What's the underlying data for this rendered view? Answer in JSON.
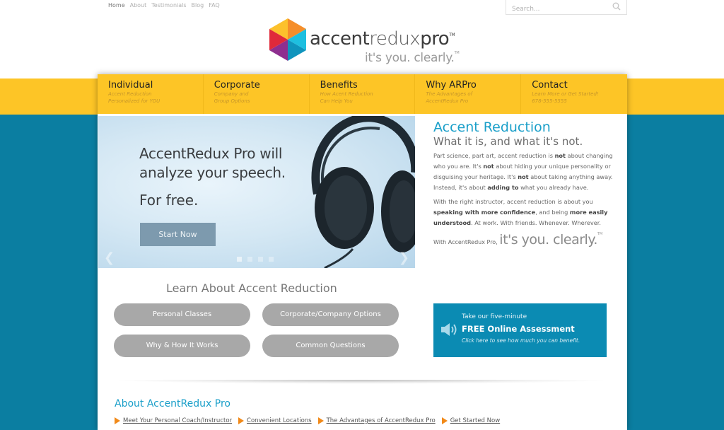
{
  "top_nav": {
    "items": [
      {
        "label": "Home",
        "active": true
      },
      {
        "label": "About"
      },
      {
        "label": "Testimonials"
      },
      {
        "label": "Blog"
      },
      {
        "label": "FAQ"
      }
    ]
  },
  "search": {
    "placeholder": "Search...",
    "icon": "search-icon"
  },
  "logo": {
    "word_bold_1": "accent",
    "word_light": "redux",
    "word_bold_2": "pro",
    "tm": "TM",
    "tagline": "it's you. clearly.",
    "tagline_tm": "TM"
  },
  "main_nav": [
    {
      "title": "Individual",
      "sub1": "Accent Reduction",
      "sub2": "Personalized for YOU"
    },
    {
      "title": "Corporate",
      "sub1": "Company and",
      "sub2": "Group Options"
    },
    {
      "title": "Benefits",
      "sub1": "How Acent Reduction",
      "sub2": "Can Help You"
    },
    {
      "title": "Why ARPro",
      "sub1": "The Advantages of",
      "sub2": "AccentRedux Pro"
    },
    {
      "title": "Contact",
      "sub1": "Learn More or Get Started!",
      "sub2": "678-555-5555"
    }
  ],
  "slider": {
    "headline_1": "AccentRedux Pro will",
    "headline_2": "analyze your speech.",
    "headline_3": "For free.",
    "button": "Start Now",
    "prev_icon": "chevron-left-icon",
    "next_icon": "chevron-right-icon",
    "slide_count": 4,
    "active_slide": 1
  },
  "about": {
    "title": "Accent Reduction",
    "subtitle": "What it is, and what it's not.",
    "p1": [
      {
        "t": "Part science, part art, accent reduction is "
      },
      {
        "t": "not",
        "b": true
      },
      {
        "t": " about changing who you are. It's "
      },
      {
        "t": "not",
        "b": true
      },
      {
        "t": " about hiding your unique personality or disguising your heritage. It's "
      },
      {
        "t": "not",
        "b": true
      },
      {
        "t": " about taking anything away. Instead, it's about "
      },
      {
        "t": "adding to",
        "b": true
      },
      {
        "t": " what you already have."
      }
    ],
    "p2": [
      {
        "t": "With the right instructor, accent reduction is about you "
      },
      {
        "t": "speaking with more confidence",
        "b": true
      },
      {
        "t": ", and being "
      },
      {
        "t": "more easily understood",
        "b": true
      },
      {
        "t": ". At work. With friends. Whenever. Wherever."
      }
    ],
    "sign_small": "With AccentRedux Pro,",
    "sign_big": "it's you. clearly.",
    "sign_tm": "TM"
  },
  "learn": {
    "title": "Learn About Accent Reduction",
    "buttons": [
      "Personal Classes",
      "Corporate/Company Options",
      "Why & How It Works",
      "Common Questions"
    ]
  },
  "assessment": {
    "line1": "Take our five-minute",
    "line2": "FREE Online Assessment",
    "line3": "Click here to see how much you can benefit."
  },
  "about2": {
    "title": "About AccentRedux Pro",
    "links": [
      "Meet Your Personal Coach/Instructor",
      "Convenient Locations",
      "The Advantages of AccentRedux Pro",
      "Get Started Now"
    ]
  },
  "colors": {
    "brand_yellow": "#fdc526",
    "brand_teal": "#0b7ea1",
    "accent_blue": "#1a9fc9",
    "pill_gray": "#a8a8a8",
    "bullet_orange": "#f18a1a"
  }
}
